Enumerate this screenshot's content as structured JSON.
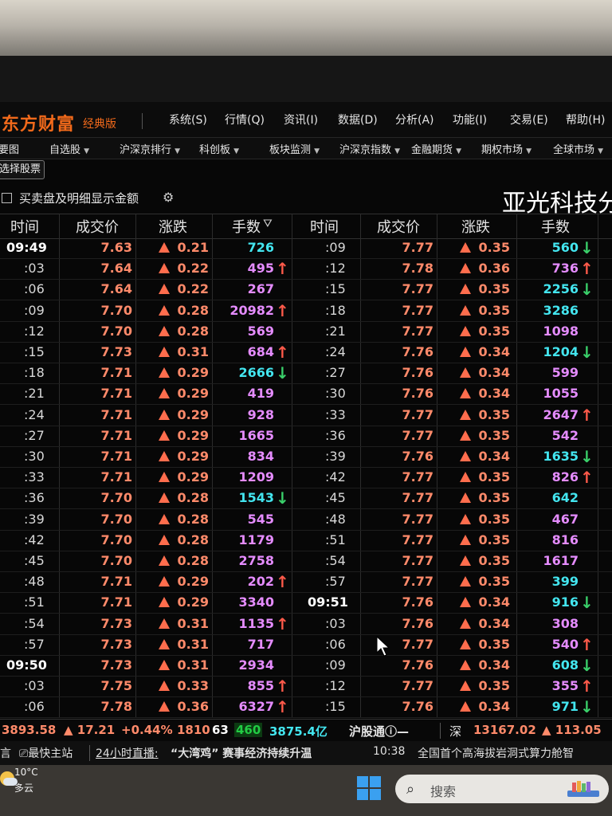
{
  "app": {
    "logo": "东方财富",
    "edition": "经典版"
  },
  "main_menu": [
    {
      "label": "系统(S)"
    },
    {
      "label": "行情(Q)"
    },
    {
      "label": "资讯(I)"
    },
    {
      "label": "数据(D)"
    },
    {
      "label": "分析(A)"
    },
    {
      "label": "功能(I)"
    },
    {
      "label": "交易(E)"
    },
    {
      "label": "帮助(H)"
    }
  ],
  "nav": [
    {
      "label": "要图"
    },
    {
      "label": "自选股"
    },
    {
      "label": "沪深京排行"
    },
    {
      "label": "科创板"
    },
    {
      "label": "板块监测"
    },
    {
      "label": "沪深京指数"
    },
    {
      "label": "金融期货"
    },
    {
      "label": "期权市场"
    },
    {
      "label": "全球市场"
    }
  ],
  "select_stocks_button": "选择股票",
  "show_amount_checkbox": {
    "label": "买卖盘及明细显示金额",
    "checked": false
  },
  "stock_name": "亚光科技分",
  "table_headers": {
    "left": [
      "时间",
      "成交价",
      "涨跌",
      "手数"
    ],
    "right": [
      "时间",
      "成交价",
      "涨跌",
      "手数"
    ]
  },
  "colors": {
    "price": "#ff8a6a",
    "up_arrow": "#ff5a4a",
    "down_arrow": "#3ad06a",
    "volume_purple": "#e58cff",
    "volume_cyan": "#43e5ef",
    "brand_orange": "#f26a1b"
  },
  "left_ticks": [
    {
      "time": "09:49",
      "price": "7.63",
      "change": "0.21",
      "volume": "726",
      "vcolor": "cyan",
      "dir": ""
    },
    {
      "time": ":03",
      "price": "7.64",
      "change": "0.22",
      "volume": "495",
      "vcolor": "purple",
      "dir": "up"
    },
    {
      "time": ":06",
      "price": "7.64",
      "change": "0.22",
      "volume": "267",
      "vcolor": "purple",
      "dir": ""
    },
    {
      "time": ":09",
      "price": "7.70",
      "change": "0.28",
      "volume": "20982",
      "vcolor": "purple",
      "dir": "up"
    },
    {
      "time": ":12",
      "price": "7.70",
      "change": "0.28",
      "volume": "569",
      "vcolor": "purple",
      "dir": ""
    },
    {
      "time": ":15",
      "price": "7.73",
      "change": "0.31",
      "volume": "684",
      "vcolor": "purple",
      "dir": "up"
    },
    {
      "time": ":18",
      "price": "7.71",
      "change": "0.29",
      "volume": "2666",
      "vcolor": "cyan",
      "dir": "down"
    },
    {
      "time": ":21",
      "price": "7.71",
      "change": "0.29",
      "volume": "419",
      "vcolor": "purple",
      "dir": ""
    },
    {
      "time": ":24",
      "price": "7.71",
      "change": "0.29",
      "volume": "928",
      "vcolor": "purple",
      "dir": ""
    },
    {
      "time": ":27",
      "price": "7.71",
      "change": "0.29",
      "volume": "1665",
      "vcolor": "purple",
      "dir": ""
    },
    {
      "time": ":30",
      "price": "7.71",
      "change": "0.29",
      "volume": "834",
      "vcolor": "purple",
      "dir": ""
    },
    {
      "time": ":33",
      "price": "7.71",
      "change": "0.29",
      "volume": "1209",
      "vcolor": "purple",
      "dir": ""
    },
    {
      "time": ":36",
      "price": "7.70",
      "change": "0.28",
      "volume": "1543",
      "vcolor": "cyan",
      "dir": "down"
    },
    {
      "time": ":39",
      "price": "7.70",
      "change": "0.28",
      "volume": "545",
      "vcolor": "purple",
      "dir": ""
    },
    {
      "time": ":42",
      "price": "7.70",
      "change": "0.28",
      "volume": "1179",
      "vcolor": "purple",
      "dir": ""
    },
    {
      "time": ":45",
      "price": "7.70",
      "change": "0.28",
      "volume": "2758",
      "vcolor": "purple",
      "dir": ""
    },
    {
      "time": ":48",
      "price": "7.71",
      "change": "0.29",
      "volume": "202",
      "vcolor": "purple",
      "dir": "up"
    },
    {
      "time": ":51",
      "price": "7.71",
      "change": "0.29",
      "volume": "3340",
      "vcolor": "purple",
      "dir": ""
    },
    {
      "time": ":54",
      "price": "7.73",
      "change": "0.31",
      "volume": "1135",
      "vcolor": "purple",
      "dir": "up"
    },
    {
      "time": ":57",
      "price": "7.73",
      "change": "0.31",
      "volume": "717",
      "vcolor": "purple",
      "dir": ""
    },
    {
      "time": "09:50",
      "price": "7.73",
      "change": "0.31",
      "volume": "2934",
      "vcolor": "purple",
      "dir": ""
    },
    {
      "time": ":03",
      "price": "7.75",
      "change": "0.33",
      "volume": "855",
      "vcolor": "purple",
      "dir": "up"
    },
    {
      "time": ":06",
      "price": "7.78",
      "change": "0.36",
      "volume": "6327",
      "vcolor": "purple",
      "dir": "up"
    }
  ],
  "right_ticks": [
    {
      "time": ":09",
      "price": "7.77",
      "change": "0.35",
      "volume": "560",
      "vcolor": "cyan",
      "dir": "down"
    },
    {
      "time": ":12",
      "price": "7.78",
      "change": "0.36",
      "volume": "736",
      "vcolor": "purple",
      "dir": "up"
    },
    {
      "time": ":15",
      "price": "7.77",
      "change": "0.35",
      "volume": "2256",
      "vcolor": "cyan",
      "dir": "down"
    },
    {
      "time": ":18",
      "price": "7.77",
      "change": "0.35",
      "volume": "3286",
      "vcolor": "cyan",
      "dir": ""
    },
    {
      "time": ":21",
      "price": "7.77",
      "change": "0.35",
      "volume": "1098",
      "vcolor": "purple",
      "dir": ""
    },
    {
      "time": ":24",
      "price": "7.76",
      "change": "0.34",
      "volume": "1204",
      "vcolor": "cyan",
      "dir": "down"
    },
    {
      "time": ":27",
      "price": "7.76",
      "change": "0.34",
      "volume": "599",
      "vcolor": "purple",
      "dir": ""
    },
    {
      "time": ":30",
      "price": "7.76",
      "change": "0.34",
      "volume": "1055",
      "vcolor": "purple",
      "dir": ""
    },
    {
      "time": ":33",
      "price": "7.77",
      "change": "0.35",
      "volume": "2647",
      "vcolor": "purple",
      "dir": "up"
    },
    {
      "time": ":36",
      "price": "7.77",
      "change": "0.35",
      "volume": "542",
      "vcolor": "purple",
      "dir": ""
    },
    {
      "time": ":39",
      "price": "7.76",
      "change": "0.34",
      "volume": "1635",
      "vcolor": "cyan",
      "dir": "down"
    },
    {
      "time": ":42",
      "price": "7.77",
      "change": "0.35",
      "volume": "826",
      "vcolor": "purple",
      "dir": "up"
    },
    {
      "time": ":45",
      "price": "7.77",
      "change": "0.35",
      "volume": "642",
      "vcolor": "cyan",
      "dir": ""
    },
    {
      "time": ":48",
      "price": "7.77",
      "change": "0.35",
      "volume": "467",
      "vcolor": "purple",
      "dir": ""
    },
    {
      "time": ":51",
      "price": "7.77",
      "change": "0.35",
      "volume": "816",
      "vcolor": "purple",
      "dir": ""
    },
    {
      "time": ":54",
      "price": "7.77",
      "change": "0.35",
      "volume": "1617",
      "vcolor": "purple",
      "dir": ""
    },
    {
      "time": ":57",
      "price": "7.77",
      "change": "0.35",
      "volume": "399",
      "vcolor": "cyan",
      "dir": ""
    },
    {
      "time": "09:51",
      "price": "7.76",
      "change": "0.34",
      "volume": "916",
      "vcolor": "cyan",
      "dir": "down"
    },
    {
      "time": ":03",
      "price": "7.76",
      "change": "0.34",
      "volume": "308",
      "vcolor": "purple",
      "dir": ""
    },
    {
      "time": ":06",
      "price": "7.77",
      "change": "0.35",
      "volume": "540",
      "vcolor": "purple",
      "dir": "up"
    },
    {
      "time": ":09",
      "price": "7.76",
      "change": "0.34",
      "volume": "608",
      "vcolor": "cyan",
      "dir": "down"
    },
    {
      "time": ":12",
      "price": "7.77",
      "change": "0.35",
      "volume": "355",
      "vcolor": "purple",
      "dir": "up"
    },
    {
      "time": ":15",
      "price": "7.76",
      "change": "0.34",
      "volume": "971",
      "vcolor": "cyan",
      "dir": "down"
    }
  ],
  "status": {
    "sh_index": "3893.58",
    "sh_change": "17.21",
    "sh_pct": "+0.44%",
    "sh_up": "1810",
    "sh_flat": "63",
    "sh_down": "460",
    "sh_amount": "3875.4亿",
    "hgt_label": "沪股通",
    "hgt_value": "—",
    "sz_label": "深",
    "sz_index": "13167.02",
    "sz_change": "113.05"
  },
  "news": {
    "prefix": "言",
    "fast_link": "最快主站",
    "live_label": "24小时直播:",
    "headline1": "“大湾鸡” 赛事经济持续升温",
    "time": "10:38",
    "headline2": "全国首个高海拔岩洞式算力舱智"
  },
  "taskbar": {
    "temperature": "10°C",
    "weather": "多云",
    "search_placeholder": "搜索"
  }
}
